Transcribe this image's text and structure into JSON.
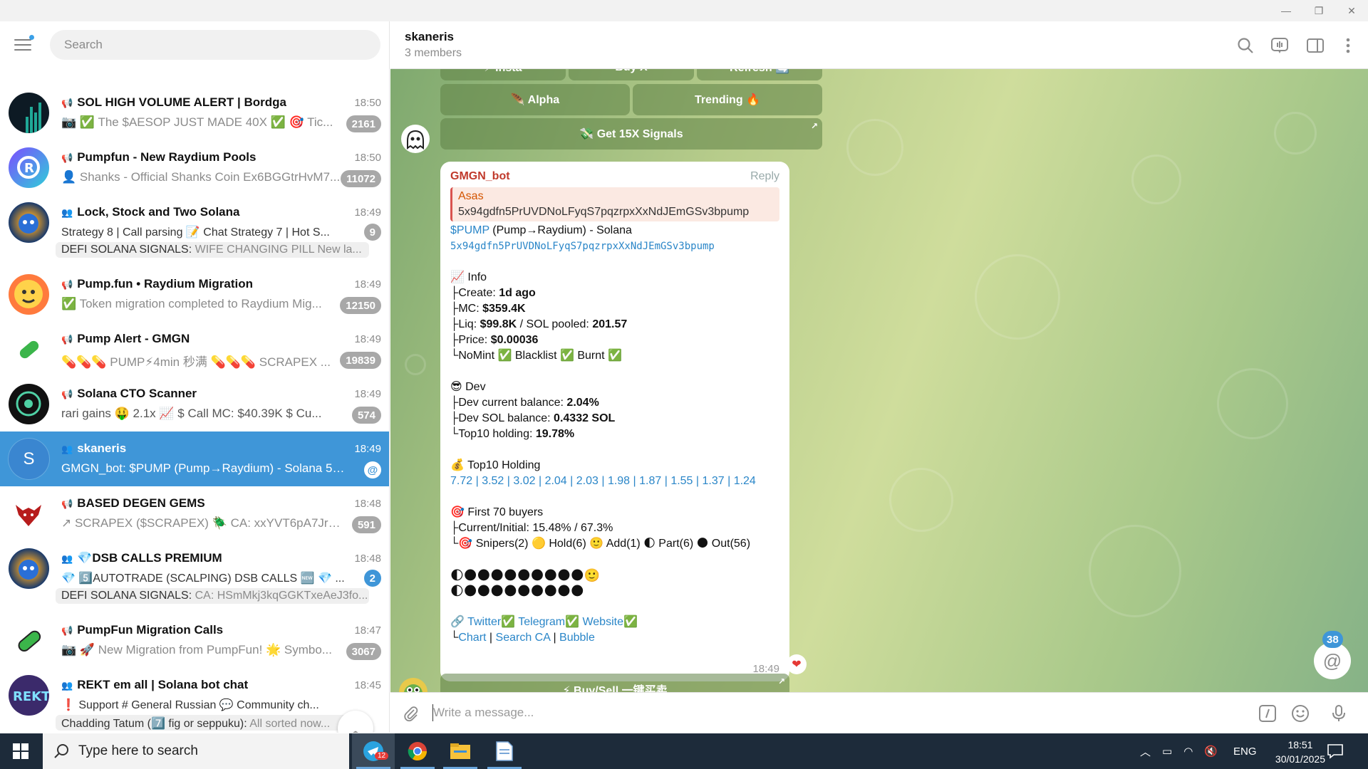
{
  "window": {
    "minimize": "—",
    "restore": "❐",
    "close": "✕"
  },
  "sidebar": {
    "search_placeholder": "Search",
    "chats": [
      {
        "title": "SOL HIGH VOLUME ALERT | Bordga",
        "time": "18:50",
        "msg": "📷 ✅ The $AESOP JUST MADE 40X ✅   🎯 Tic...",
        "badge": "2161",
        "kind": "channel"
      },
      {
        "title": "Pumpfun - New Raydium Pools",
        "time": "18:50",
        "msg": "👤 Shanks - Official Shanks Coin  Ex6BGGtrHvM7...",
        "badge": "11072",
        "kind": "channel"
      },
      {
        "title": "Lock, Stock and Two Solana",
        "time": "18:49",
        "topics": "Strategy 8 | Call parsing   📝 Chat   Strategy 7 | Hot S...",
        "sender": "DEFI SOLANA SIGNALS:",
        "msg": "WIFE CHANGING PILL  New la...",
        "badge": "9",
        "kind": "group"
      },
      {
        "title": "Pump.fun • Raydium Migration",
        "time": "18:49",
        "msg": "✅ Token migration completed to Raydium    Mig...",
        "badge": "12150",
        "kind": "channel"
      },
      {
        "title": "Pump Alert - GMGN",
        "time": "18:49",
        "msg": "💊💊💊 PUMP⚡4min 秒满 💊💊💊   SCRAPEX ...",
        "badge": "19839",
        "kind": "channel"
      },
      {
        "title": "Solana CTO Scanner",
        "time": "18:49",
        "msg": "rari gains 🤑 2.1x 📈   $ Call MC: $40.39K   $ Cu...",
        "badge": "574",
        "kind": "channel"
      },
      {
        "title": "skaneris",
        "time": "18:49",
        "msg": "GMGN_bot: $PUMP (Pump→Raydium) - Solana 5x94...",
        "badge": "@",
        "kind": "group",
        "active": true
      },
      {
        "title": "BASED DEGEN GEMS",
        "time": "18:48",
        "msg": "↗ SCRAPEX ($SCRAPEX)  🪲 CA: xxYVT6pA7Jrdar2...",
        "badge": "591",
        "kind": "channel"
      },
      {
        "title": "💎DSB CALLS PREMIUM",
        "time": "18:48",
        "topics": "💎 5️⃣AUTOTRADE (SCALPING) DSB CALLS 🆕   💎 ...",
        "sender": "DEFI SOLANA SIGNALS:",
        "msg": "CA: HSmMkj3kqGGKTxeAeJ3fo...",
        "badge": "2",
        "kind": "group"
      },
      {
        "title": "PumpFun Migration Calls",
        "time": "18:47",
        "msg": "📷 🚀 New Migration from PumpFun! 🌟   Symbo...",
        "badge": "3067",
        "kind": "channel"
      },
      {
        "title": "REKT em all | Solana bot chat",
        "time": "18:45",
        "topics": "❗ Support   # General   Russian   💬 Community ch...",
        "sender": "Chadding Tatum (7️⃣ fig or seppuku):",
        "msg": "All sorted now...",
        "badge": "",
        "kind": "group"
      }
    ]
  },
  "header": {
    "name": "skaneris",
    "members": "3 members"
  },
  "keyboard_top": [
    {
      "label": "⚡ Insta"
    },
    {
      "label": "Buy X"
    },
    {
      "label": "Refresh 🔄"
    }
  ],
  "keyboard_mid": [
    {
      "label": "🪶 Alpha"
    },
    {
      "label": "Trending 🔥"
    }
  ],
  "keyboard_signals": {
    "label": "💸 Get 15X Signals"
  },
  "message": {
    "sender": "GMGN_bot",
    "reply": "Reply",
    "quote_name": "Asas",
    "quote_text": "5x94gdfn5PrUVDNoLFyqS7pqzrpxXxNdJEmGSv3bpump",
    "token": "$PUMP",
    "route": " (Pump→Raydium) - Solana",
    "ca": "5x94gdfn5PrUVDNoLFyqS7pqzrpxXxNdJEmGSv3bpump",
    "info_head": "📈 Info",
    "create_label": "├Create: ",
    "create_val": "1d  ago",
    "mc_label": "├MC: ",
    "mc_val": "$359.4K",
    "liq_label": "├Liq: ",
    "liq_val": "$99.8K",
    "sol_label": " / SOL pooled: ",
    "sol_val": "201.57",
    "price_label": "├Price: ",
    "price_val": "$0.00036",
    "flags": "└NoMint ✅ Blacklist ✅ Burnt ✅",
    "dev_head": "😎 Dev",
    "devbal_label": "├Dev current balance: ",
    "devbal_val": "2.04%",
    "devsol_label": "├Dev SOL balance: ",
    "devsol_val": "0.4332 SOL",
    "top10_label": "└Top10 holding: ",
    "top10_val": "19.78%",
    "holding_head": "💰 Top10 Holding",
    "holding_vals": "7.72 | 3.52 | 3.02 | 2.04 | 2.03 | 1.98 | 1.87 | 1.55 | 1.37 | 1.24",
    "buyers_head": "🎯 First 70 buyers",
    "ratio": "├Current/Initial: 15.48% / 67.3%",
    "snipers": "└🎯 Snipers(2) 🟡 Hold(6) 🙂 Add(1) 🌓 Part(6) 🌑 Out(56)",
    "dots1": "🌓🌑🌑🌑🌑🌑🌑🌑🌑🌑🙂",
    "dots2": "🌓🌑🌑🌑🌑🌑🌑🌑🌑🌑",
    "links_prefix": "🔗 ",
    "twitter": "Twitter",
    "telegram": "Telegram",
    "website": "Website",
    "chart": "Chart",
    "searchca": "Search CA",
    "bubble": "Bubble",
    "time": "18:49"
  },
  "buysell": {
    "label": "⚡ Buy/Sell 一键买卖"
  },
  "mentions": {
    "count": "38"
  },
  "composer": {
    "placeholder": "Write a message..."
  },
  "taskbar": {
    "search": "Type here to search",
    "telegram_badge": "12",
    "lang": "ENG",
    "time": "18:51",
    "date": "30/01/2025"
  }
}
